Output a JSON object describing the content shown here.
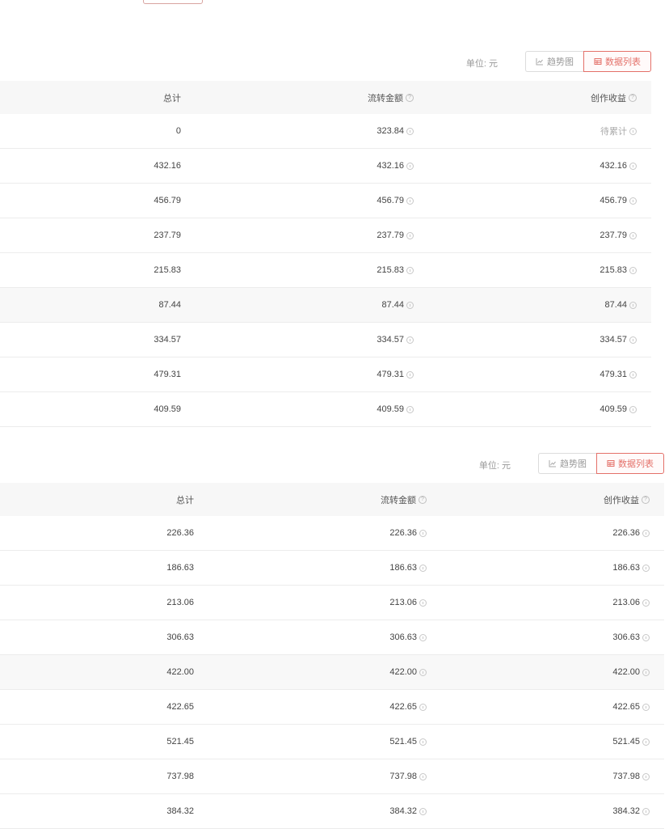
{
  "tables": [
    {
      "unit_label": "单位: 元",
      "trend_button": "趋势图",
      "list_button": "数据列表",
      "columns": [
        "总计",
        "流转金额",
        "创作收益"
      ],
      "rows": [
        {
          "total": "0",
          "flow": "323.84",
          "income": "待累计"
        },
        {
          "total": "432.16",
          "flow": "432.16",
          "income": "432.16"
        },
        {
          "total": "456.79",
          "flow": "456.79",
          "income": "456.79"
        },
        {
          "total": "237.79",
          "flow": "237.79",
          "income": "237.79"
        },
        {
          "total": "215.83",
          "flow": "215.83",
          "income": "215.83"
        },
        {
          "total": "87.44",
          "flow": "87.44",
          "income": "87.44"
        },
        {
          "total": "334.57",
          "flow": "334.57",
          "income": "334.57"
        },
        {
          "total": "479.31",
          "flow": "479.31",
          "income": "479.31"
        },
        {
          "total": "409.59",
          "flow": "409.59",
          "income": "409.59"
        }
      ]
    },
    {
      "unit_label": "单位: 元",
      "trend_button": "趋势图",
      "list_button": "数据列表",
      "columns": [
        "总计",
        "流转金额",
        "创作收益"
      ],
      "rows": [
        {
          "total": "226.36",
          "flow": "226.36",
          "income": "226.36"
        },
        {
          "total": "186.63",
          "flow": "186.63",
          "income": "186.63"
        },
        {
          "total": "213.06",
          "flow": "213.06",
          "income": "213.06"
        },
        {
          "total": "306.63",
          "flow": "306.63",
          "income": "306.63"
        },
        {
          "total": "422.00",
          "flow": "422.00",
          "income": "422.00"
        },
        {
          "total": "422.65",
          "flow": "422.65",
          "income": "422.65"
        },
        {
          "total": "521.45",
          "flow": "521.45",
          "income": "521.45"
        },
        {
          "total": "737.98",
          "flow": "737.98",
          "income": "737.98"
        },
        {
          "total": "384.32",
          "flow": "384.32",
          "income": "384.32"
        }
      ]
    }
  ],
  "colors": {
    "accent": "#e4716a",
    "header_bg": "#f7f7f7",
    "row_highlight": "#f8f8f8"
  },
  "icons": {
    "trend": "line-chart-icon",
    "list": "table-icon",
    "help": "question-circle-icon",
    "info": "info-circle-icon"
  }
}
